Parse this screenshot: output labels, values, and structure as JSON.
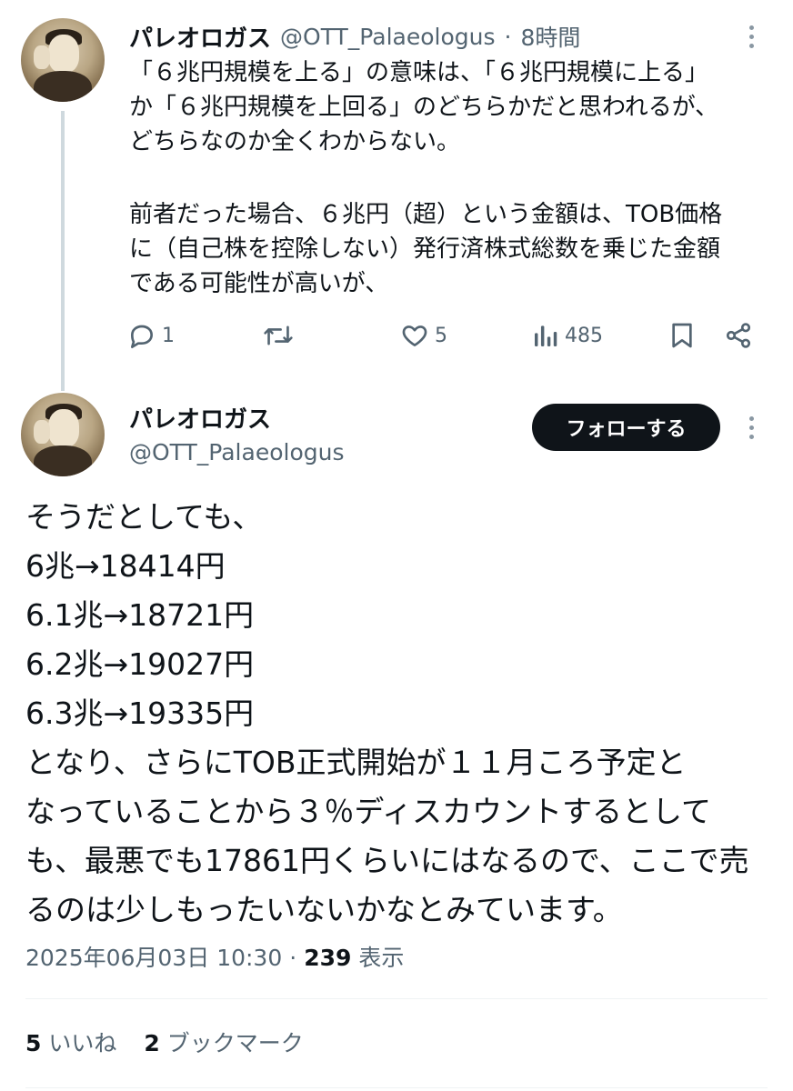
{
  "reply_tweet": {
    "display_name": "パレオロガス",
    "handle": "@OTT_Palaeologus",
    "separator": "·",
    "time": "8時間",
    "text_lines": [
      "「６兆円規模を上る」の意味は、「６兆円規模に上る」",
      "か「６兆円規模を上回る」のどちらかだと思われるが、",
      "どちらなのか全くわからない。",
      "",
      "前者だった場合、６兆円（超）という金額は、TOB価格",
      "に（自己株を控除しない）発行済株式総数を乗じた金額",
      "である可能性が高いが、"
    ],
    "actions": {
      "replies": "1",
      "retweets": "",
      "likes": "5",
      "views": "485"
    }
  },
  "main_tweet": {
    "display_name": "パレオロガス",
    "handle": "@OTT_Palaeologus",
    "follow_label": "フォローする",
    "text_lines": [
      "そうだとしても、",
      "6兆→18414円",
      "6.1兆→18721円",
      "6.2兆→19027円",
      "6.3兆→19335円",
      "となり、さらにTOB正式開始が１１月ころ予定と",
      "なっていることから３％ディスカウントするとして",
      "も、最悪でも17861円くらいにはなるので、ここで売",
      "るのは少しもったいないかなとみています。"
    ],
    "timestamp": "2025年06月03日 10:30",
    "meta_separator": "·",
    "views_count": "239",
    "views_label": "表示",
    "likes_count": "5",
    "likes_label": "いいね",
    "bookmarks_count": "2",
    "bookmarks_label": "ブックマーク"
  },
  "icons": [
    "more-icon",
    "reply-icon",
    "retweet-icon",
    "like-icon",
    "views-icon",
    "bookmark-icon",
    "share-icon"
  ],
  "colors": {
    "text": "#0f1419",
    "muted": "#536471",
    "thread_line": "#cfd9de",
    "follow_button_bg": "#0f1419",
    "follow_button_text": "#ffffff"
  }
}
